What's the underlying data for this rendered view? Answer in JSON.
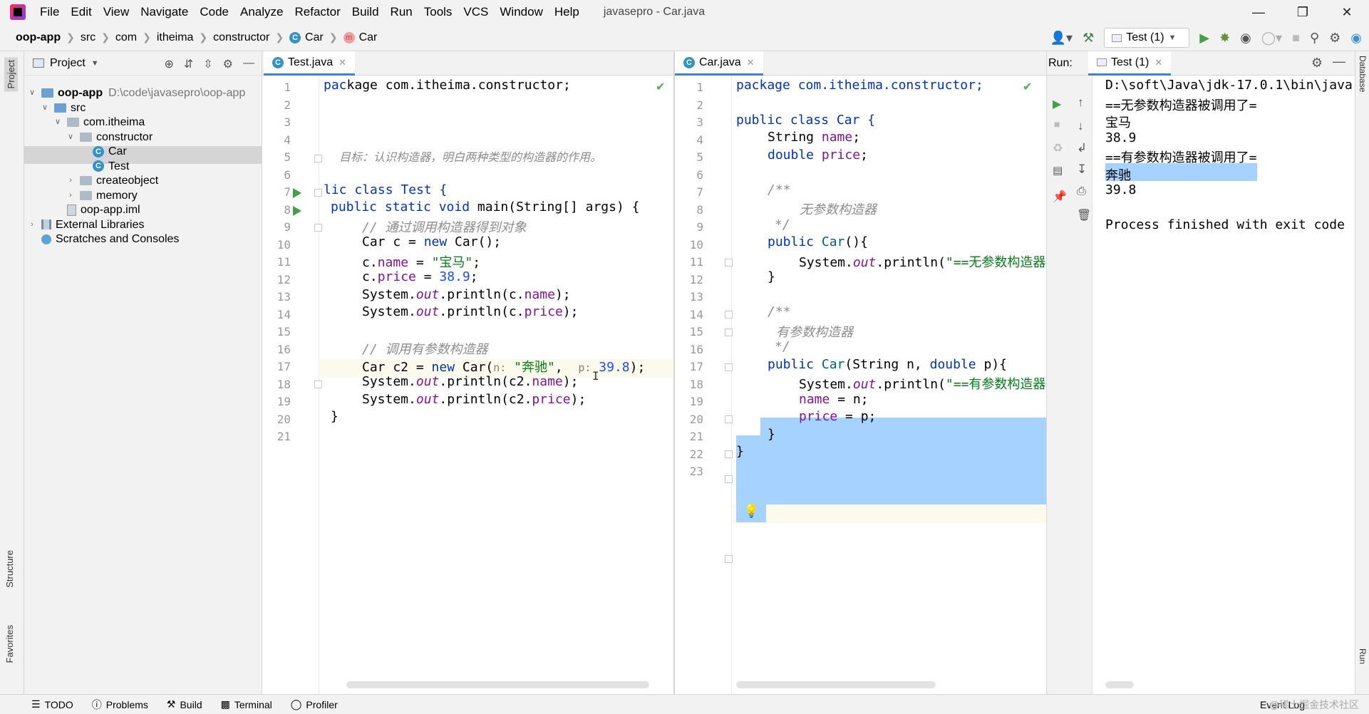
{
  "menubar": {
    "items": [
      "File",
      "Edit",
      "View",
      "Navigate",
      "Code",
      "Analyze",
      "Refactor",
      "Build",
      "Run",
      "Tools",
      "VCS",
      "Window",
      "Help"
    ],
    "title": "javasepro - Car.java"
  },
  "navbar": {
    "crumbs": [
      "oop-app",
      "src",
      "com",
      "itheima",
      "constructor",
      "Car",
      "Car"
    ],
    "run_config": "Test (1)"
  },
  "left_stripe": {
    "project": "Project",
    "structure": "Structure",
    "favorites": "Favorites"
  },
  "project": {
    "header": "Project",
    "tree": [
      {
        "label": "oop-app",
        "extra": "D:\\code\\javasepro\\oop-app",
        "depth": 0,
        "arrow": "v"
      },
      {
        "label": "src",
        "depth": 1,
        "arrow": "v"
      },
      {
        "label": "com.itheima",
        "depth": 2,
        "arrow": "v"
      },
      {
        "label": "constructor",
        "depth": 3,
        "arrow": "v"
      },
      {
        "label": "Car",
        "depth": 4,
        "arrow": ""
      },
      {
        "label": "Test",
        "depth": 4,
        "arrow": ""
      },
      {
        "label": "createobject",
        "depth": 3,
        "arrow": ">"
      },
      {
        "label": "memory",
        "depth": 3,
        "arrow": ">"
      },
      {
        "label": "oop-app.iml",
        "depth": 2,
        "arrow": ""
      },
      {
        "label": "External Libraries",
        "depth": 0,
        "arrow": ">"
      },
      {
        "label": "Scratches and Consoles",
        "depth": 0,
        "arrow": ""
      }
    ]
  },
  "editor_left": {
    "tab": "Test.java",
    "line_numbers": [
      "1",
      "2",
      "3",
      "4",
      "5",
      "6",
      "7",
      "8",
      "9",
      "10",
      "11",
      "12",
      "13",
      "14",
      "15",
      "16",
      "17",
      "18",
      "19",
      "20",
      "21"
    ],
    "lines": {
      "l1": "kage com.itheima.constructor;",
      "l4": "目标：认识构造器，明白两种类型的构造器的作用。",
      "l6": "lic class Test {",
      "l7": "public static void main(String[] args) {",
      "l8": "// 通过调用构造器得到对象",
      "l9": "Car c = new Car();",
      "l10": "c.name = \"宝马\";",
      "l11": "c.price = 38.9;",
      "l12": "System.out.println(c.name);",
      "l13": "System.out.println(c.price);",
      "l15": "// 调用有参数构造器",
      "l16_a": "Car c2 = new Car(",
      "l16_hint_n": "n:",
      "l16_str": "\"奔驰\"",
      "l16_hint_p": "p:",
      "l16_num": "39.8",
      "l16_end": ");",
      "l17": "System.out.println(c2.name);",
      "l18": "System.out.println(c2.price);",
      "l19": "}"
    }
  },
  "editor_right": {
    "tab": "Car.java",
    "line_numbers": [
      "1",
      "2",
      "3",
      "4",
      "5",
      "6",
      "7",
      "8",
      "9",
      "10",
      "11",
      "12",
      "13",
      "14",
      "15",
      "16",
      "17",
      "18",
      "19",
      "20",
      "21",
      "22",
      "23"
    ],
    "lines": {
      "l1": "package com.itheima.constructor;",
      "l3": "public class Car {",
      "l4": "String name;",
      "l5": "double price;",
      "l7": "/**",
      "l8": "无参数构造器",
      "l9": "*/",
      "l10": "public Car(){",
      "l11": "System.out.println(\"==无参数构造器",
      "l12": "}",
      "l14": "/**",
      "l15": "有参数构造器",
      "l16": "*/",
      "l17": "public Car(String n, double p){",
      "l18": "System.out.println(\"==有参数构造器",
      "l19": "name = n;",
      "l20": "price = p;",
      "l21": "}",
      "l22": "}"
    }
  },
  "run": {
    "label": "Run:",
    "tab": "Test (1)",
    "output": [
      "D:\\soft\\Java\\jdk-17.0.1\\bin\\java",
      "==无参数构造器被调用了=",
      "宝马",
      "38.9",
      "==有参数构造器被调用了=",
      "奔驰",
      "39.8",
      "",
      "Process finished with exit code"
    ]
  },
  "right_stripe": {
    "database": "Database",
    "run": "Run"
  },
  "bottombar": {
    "items": [
      "TODO",
      "Problems",
      "Build",
      "Terminal",
      "Profiler"
    ],
    "event_log": "Event Log",
    "watermark": "@稀土掘金技术社区"
  }
}
